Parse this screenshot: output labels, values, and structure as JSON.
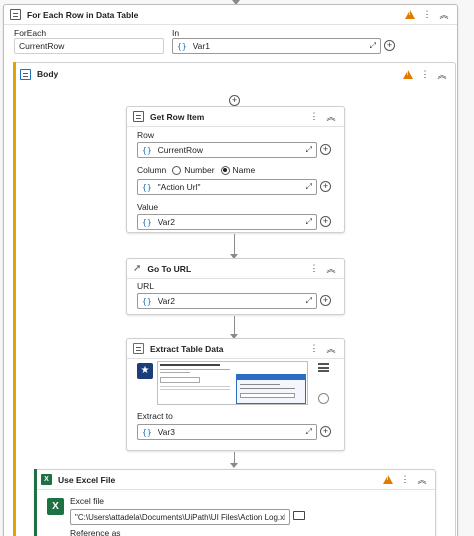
{
  "foreach": {
    "title": "For Each Row in Data Table",
    "foreach_label": "ForEach",
    "foreach_value": "CurrentRow",
    "in_label": "In",
    "in_value": "Var1"
  },
  "body": {
    "title": "Body"
  },
  "get_row_item": {
    "title": "Get Row Item",
    "row_label": "Row",
    "row_value": "CurrentRow",
    "column_label": "Column",
    "opt_number": "Number",
    "opt_name": "Name",
    "column_value": "\"Action Url\"",
    "value_label": "Value",
    "value_value": "Var2"
  },
  "go_to_url": {
    "title": "Go To URL",
    "url_label": "URL",
    "url_value": "Var2"
  },
  "extract_table": {
    "title": "Extract Table Data",
    "extract_to_label": "Extract to",
    "extract_to_value": "Var3"
  },
  "use_excel": {
    "title": "Use Excel File",
    "excel_file_label": "Excel file",
    "excel_file_value": "\"C:\\Users\\attadela\\Documents\\UiPath\\UI Files\\Action Log.xlsx\"",
    "reference_as_label": "Reference as"
  },
  "colors": {
    "accent": "#1d6fb8",
    "warning": "#e07b00",
    "excel_green": "#1e7145",
    "body_bar": "#e4a100"
  },
  "icons": {
    "warning": "warning-icon",
    "more": "more-icon",
    "collapse": "collapse-icon",
    "expand_editor": "expand-editor-icon",
    "add": "plus-icon",
    "folder": "folder-icon"
  }
}
